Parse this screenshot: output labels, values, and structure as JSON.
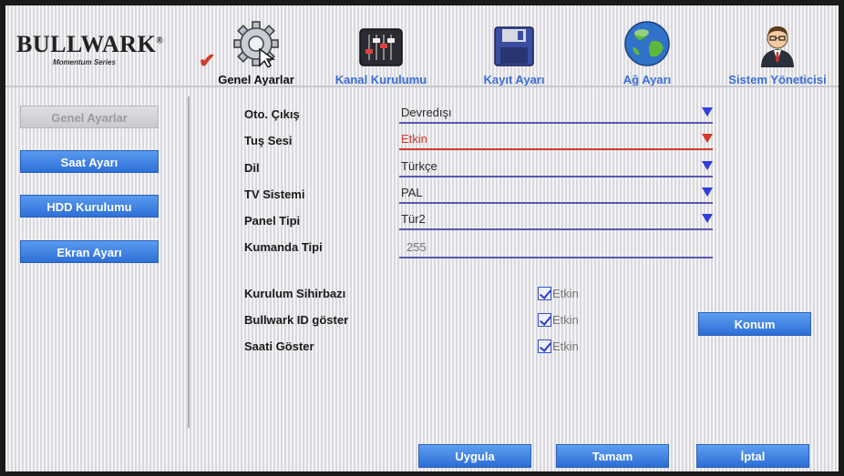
{
  "brand": {
    "name": "BULLWARK",
    "registered": "®",
    "tagline": "Momentum Series"
  },
  "tabs": [
    {
      "label": "Genel Ayarlar",
      "icon": "gear-icon",
      "active": true
    },
    {
      "label": "Kanal Kurulumu",
      "icon": "mixer-sliders-icon",
      "active": false
    },
    {
      "label": "Kayıt Ayarı",
      "icon": "floppy-disk-icon",
      "active": false
    },
    {
      "label": "Ağ Ayarı",
      "icon": "globe-icon",
      "active": false
    },
    {
      "label": "Sistem Yöneticisi",
      "icon": "admin-user-icon",
      "active": false
    }
  ],
  "sidebar": {
    "items": [
      {
        "label": "Genel Ayarlar",
        "disabled": true
      },
      {
        "label": "Saat Ayarı",
        "disabled": false
      },
      {
        "label": "HDD Kurulumu",
        "disabled": false
      },
      {
        "label": "Ekran Ayarı",
        "disabled": false
      }
    ]
  },
  "settings": {
    "oto_cikis": {
      "label": "Oto. Çıkış",
      "value": "Devredışı"
    },
    "tus_sesi": {
      "label": "Tuş Sesi",
      "value": "Etkin"
    },
    "dil": {
      "label": "Dil",
      "value": "Türkçe"
    },
    "tv_sistemi": {
      "label": "TV Sistemi",
      "value": "PAL"
    },
    "panel_tipi": {
      "label": "Panel Tipi",
      "value": "Tür2"
    },
    "kumanda_tipi": {
      "label": "Kumanda Tipi",
      "value": "255"
    }
  },
  "toggles": {
    "kurulum_sihirbazi": {
      "label": "Kurulum Sihirbazı",
      "checkbox_label": "Etkin",
      "checked": true
    },
    "bullwark_id": {
      "label": "Bullwark ID göster",
      "checkbox_label": "Etkin",
      "checked": true
    },
    "saati_goster": {
      "label": "Saati Göster",
      "checkbox_label": "Etkin",
      "checked": true
    }
  },
  "buttons": {
    "konum": "Konum",
    "uygula": "Uygula",
    "tamam": "Tamam",
    "iptal": "İptal"
  },
  "colors": {
    "accent": "#2d6fd6",
    "active_red": "#d23a2a",
    "field_underline": "#5b57b0"
  }
}
